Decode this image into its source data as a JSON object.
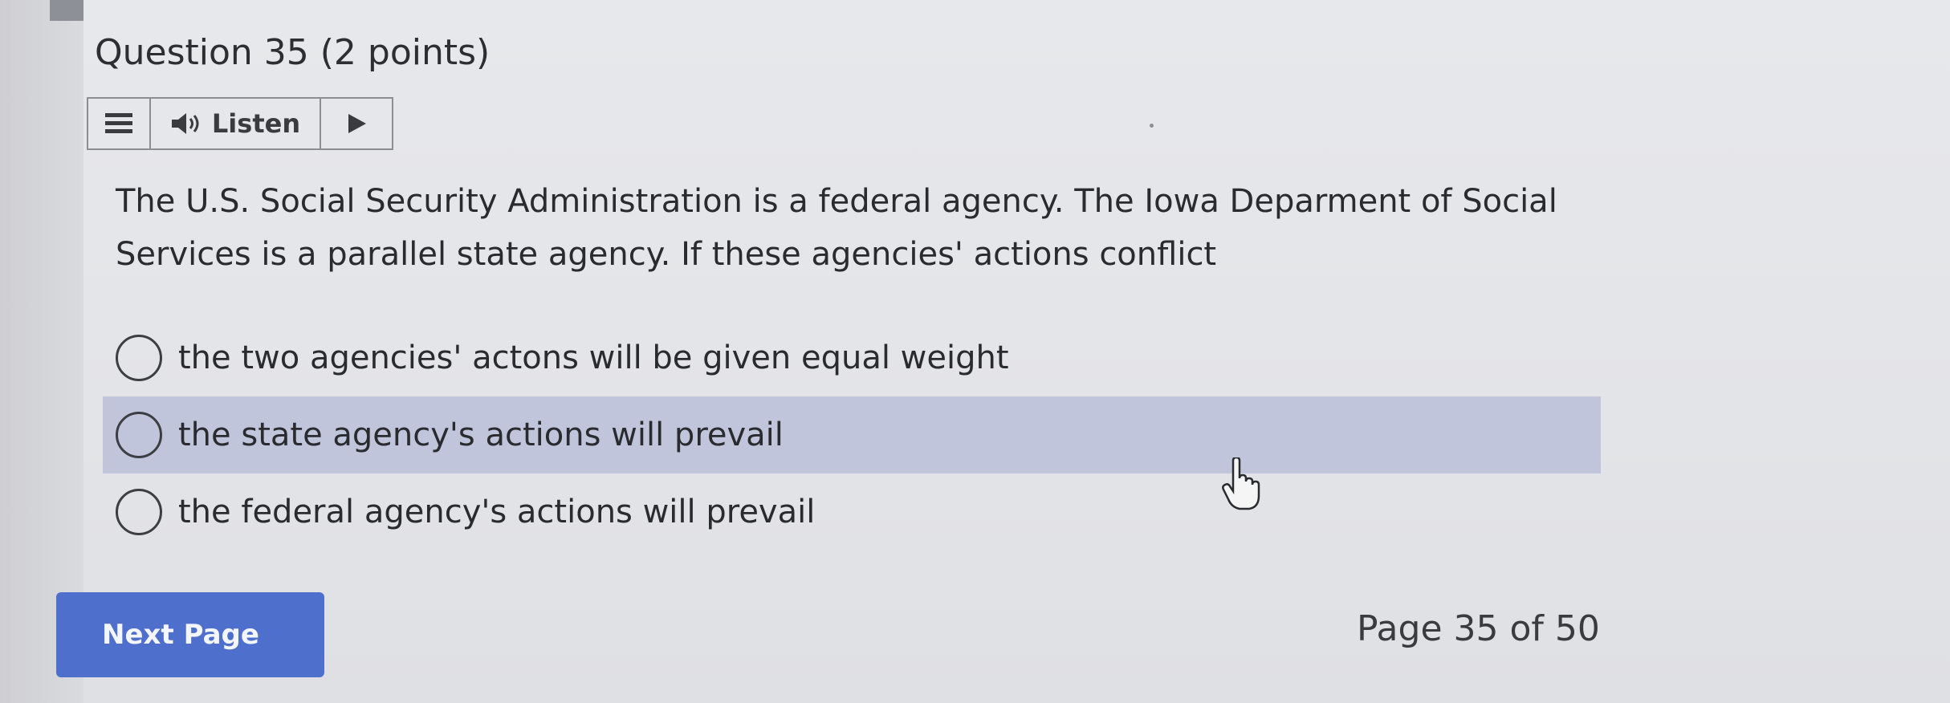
{
  "question": {
    "title": "Question 35 (2 points)",
    "text": "The U.S. Social Security Administration is a federal agency. The Iowa Deparment of Social Services is a parallel state agency.  If these agencies' actions conflict"
  },
  "toolbar": {
    "menu_icon": "menu-icon",
    "speaker_icon": "speaker-icon",
    "listen_label": "Listen",
    "play_icon": "play-icon"
  },
  "options": [
    {
      "label": "the two agencies' actons will be given equal weight",
      "selected": false,
      "highlighted": false
    },
    {
      "label": "the state agency's actions will prevail",
      "selected": false,
      "highlighted": true
    },
    {
      "label": "the federal agency's actions will prevail",
      "selected": false,
      "highlighted": false
    }
  ],
  "navigation": {
    "next_label": "Next Page",
    "page_indicator": "Page 35 of 50"
  },
  "colors": {
    "button_blue": "#4f6fcc",
    "highlight": "#c0c5dc",
    "background": "#e4e5e8"
  }
}
